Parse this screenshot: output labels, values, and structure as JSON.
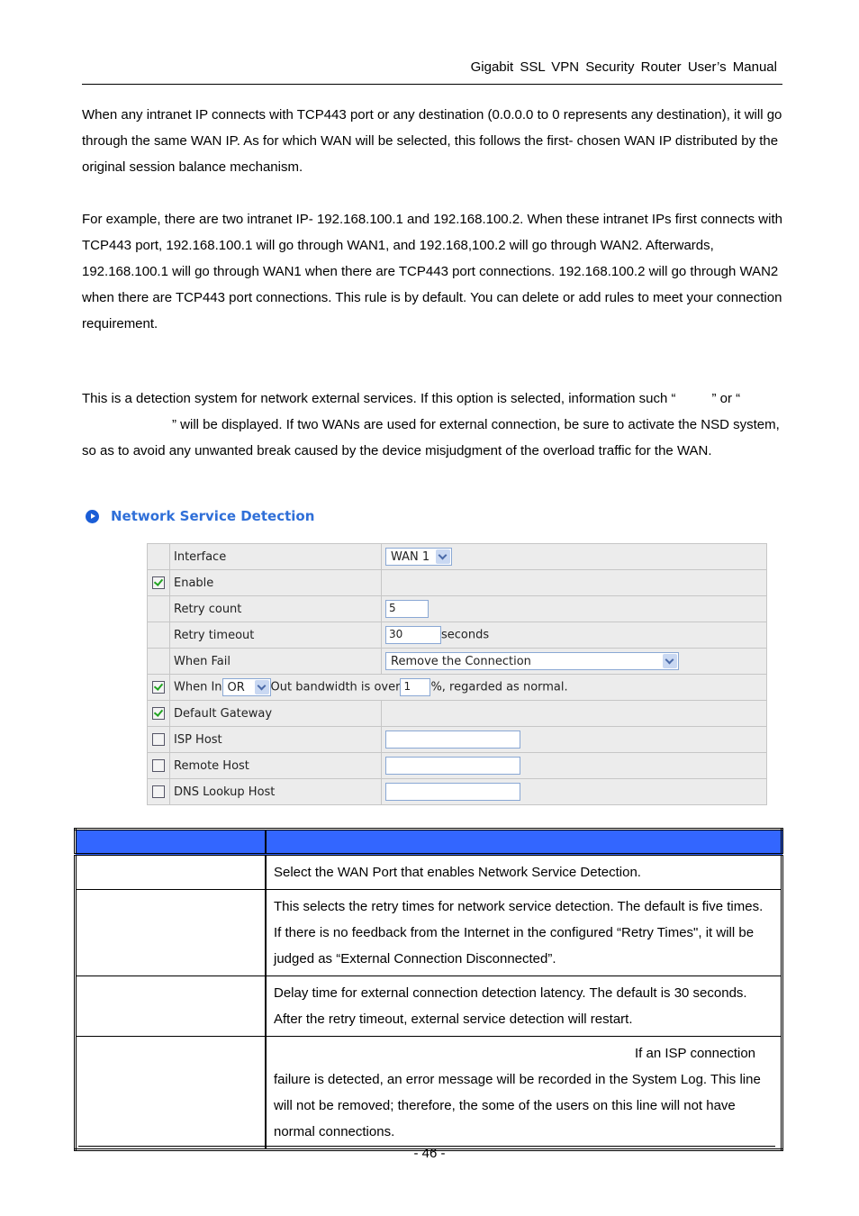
{
  "header": {
    "title": "Gigabit SSL VPN Security Router User’s Manual"
  },
  "paragraphs": {
    "p1": "When any intranet IP connects with TCP443 port or any destination (0.0.0.0 to 0 represents any destination), it will go through the same WAN IP. As for which WAN will be selected, this follows the first- chosen WAN IP distributed by the original session balance mechanism.",
    "p2": "For example, there are two intranet IP- 192.168.100.1 and 192.168.100.2. When these intranet IPs first connects with TCP443 port, 192.168.100.1 will go through WAN1, and 192.168,100.2 will go through WAN2. Afterwards, 192.168.100.1 will go through WAN1 when there are TCP443 port connections. 192.168.100.2 will go through WAN2 when there are TCP443 port connections. This rule is by default. You can delete or add rules to meet your connection requirement.",
    "p3_a": "This is a detection system for network external services. If this option is selected, information such “",
    "p3_b": "” or “",
    "p3_c": "” will be displayed. If two WANs are used for external connection, be sure to activate the NSD system, so as to avoid any unwanted break caused by the device misjudgment of the overload traffic for the WAN."
  },
  "section": {
    "icon": "circle-play-icon",
    "title": "Network Service Detection"
  },
  "nsd_form": {
    "interface": {
      "label": "Interface",
      "value": "WAN 1"
    },
    "enable": {
      "label": "Enable",
      "checked": true
    },
    "retry_count": {
      "label": "Retry count",
      "value": "5"
    },
    "retry_timeout": {
      "label": "Retry timeout",
      "value": "30",
      "unit": "seconds"
    },
    "when_fail": {
      "label": "When Fail",
      "value": "Remove the Connection"
    },
    "bandwidth": {
      "checked": true,
      "prefix": "When In",
      "operator": "OR",
      "middle": "Out bandwidth is over",
      "value": "1",
      "suffix": "%,  regarded as normal."
    },
    "default_gateway": {
      "label": "Default Gateway",
      "checked": true
    },
    "isp_host": {
      "label": "ISP Host",
      "checked": false,
      "value": ""
    },
    "remote_host": {
      "label": "Remote Host",
      "checked": false,
      "value": ""
    },
    "dns_lookup_host": {
      "label": "DNS Lookup Host",
      "checked": false,
      "value": ""
    }
  },
  "desc_table": {
    "header": {
      "col1": "",
      "col2": ""
    },
    "rows": [
      {
        "name": "",
        "text": "Select the WAN Port that enables Network Service Detection."
      },
      {
        "name": "",
        "text": "This selects the retry times for network service detection. The default is five times. If there is no feedback from the Internet in the configured “Retry Times\", it will be judged as “External Connection Disconnected”."
      },
      {
        "name": "",
        "text": "Delay time for external connection detection latency. The default is 30 seconds. After the retry timeout, external service detection will restart."
      },
      {
        "name": "",
        "text_first": "If an ISP connection",
        "text": "failure is detected, an error message will be recorded in the System Log. This line will not be removed; therefore, the some of the users on this line will not have normal connections."
      }
    ]
  },
  "footer": {
    "page_number": "- 46 -"
  }
}
